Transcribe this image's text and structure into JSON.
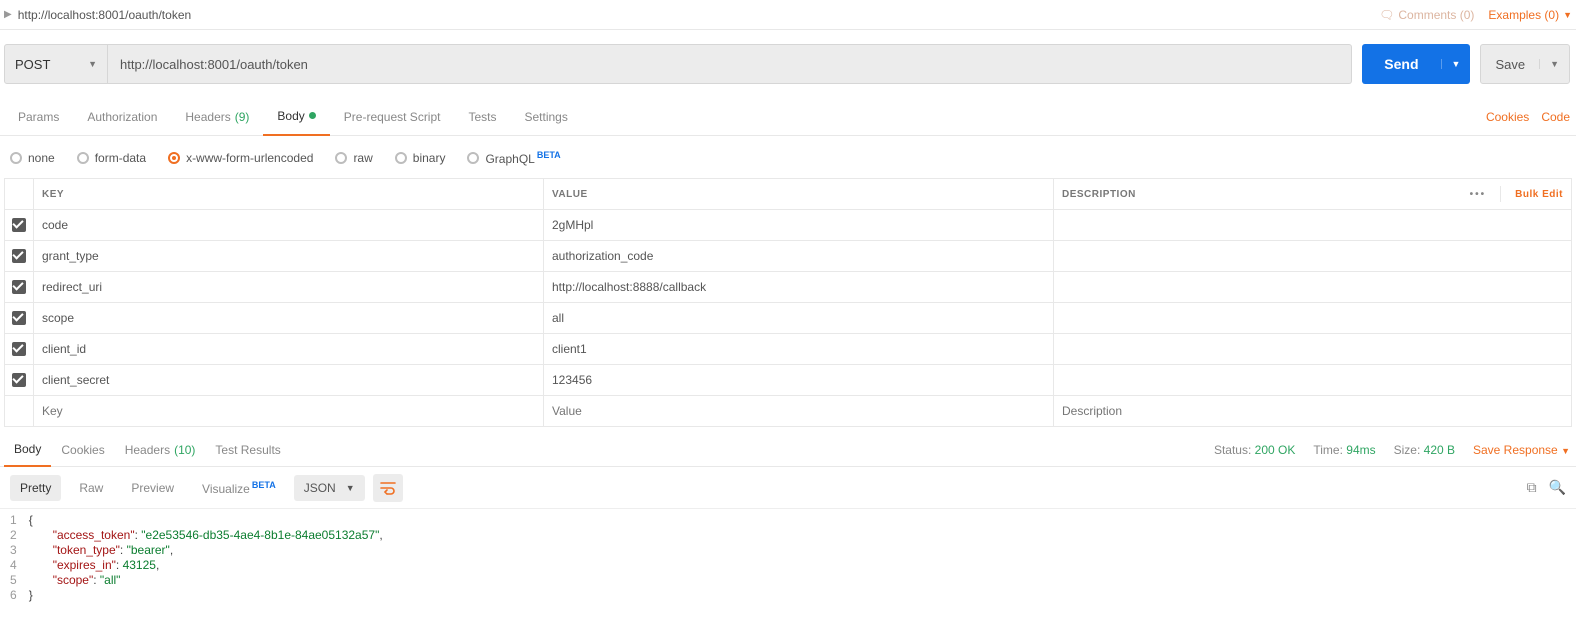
{
  "header": {
    "title": "http://localhost:8001/oauth/token",
    "comments_label": "Comments (0)",
    "examples_label": "Examples (0)"
  },
  "request": {
    "method": "POST",
    "url": "http://localhost:8001/oauth/token",
    "send_label": "Send",
    "save_label": "Save"
  },
  "req_tabs": {
    "params": "Params",
    "auth": "Authorization",
    "headers_lbl": "Headers",
    "headers_count": "(9)",
    "body": "Body",
    "prerequest": "Pre-request Script",
    "tests": "Tests",
    "settings": "Settings",
    "cookies": "Cookies",
    "code": "Code"
  },
  "body_types": {
    "none": "none",
    "formdata": "form-data",
    "xwww": "x-www-form-urlencoded",
    "raw": "raw",
    "binary": "binary",
    "graphql": "GraphQL",
    "beta": "BETA"
  },
  "kv_head": {
    "key": "KEY",
    "value": "VALUE",
    "desc": "DESCRIPTION",
    "bulk": "Bulk Edit"
  },
  "kv_rows": [
    {
      "key": "code",
      "value": "2gMHpl"
    },
    {
      "key": "grant_type",
      "value": "authorization_code"
    },
    {
      "key": "redirect_uri",
      "value": "http://localhost:8888/callback"
    },
    {
      "key": "scope",
      "value": "all"
    },
    {
      "key": "client_id",
      "value": "client1"
    },
    {
      "key": "client_secret",
      "value": "123456"
    }
  ],
  "kv_placeholder": {
    "key": "Key",
    "value": "Value",
    "desc": "Description"
  },
  "resp_tabs": {
    "body": "Body",
    "cookies": "Cookies",
    "headers_lbl": "Headers",
    "headers_count": "(10)",
    "tests": "Test Results"
  },
  "resp_meta": {
    "status_lbl": "Status:",
    "status_val": "200 OK",
    "time_lbl": "Time:",
    "time_val": "94ms",
    "size_lbl": "Size:",
    "size_val": "420 B",
    "save_resp": "Save Response"
  },
  "view": {
    "pretty": "Pretty",
    "raw": "Raw",
    "preview": "Preview",
    "visualize": "Visualize",
    "beta": "BETA",
    "format": "JSON"
  },
  "json_body": {
    "access_token_k": "\"access_token\"",
    "access_token_v": "\"e2e53546-db35-4ae4-8b1e-84ae05132a57\"",
    "token_type_k": "\"token_type\"",
    "token_type_v": "\"bearer\"",
    "expires_in_k": "\"expires_in\"",
    "expires_in_v": "43125",
    "scope_k": "\"scope\"",
    "scope_v": "\"all\""
  },
  "ln": {
    "l1": "1",
    "l2": "2",
    "l3": "3",
    "l4": "4",
    "l5": "5",
    "l6": "6"
  }
}
